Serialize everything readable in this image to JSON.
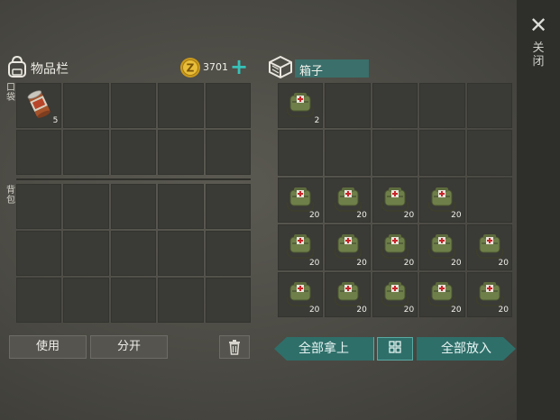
{
  "inventory": {
    "title": "物品栏",
    "coins": "3701",
    "pocket_label": "口袋",
    "backpack_label": "背包",
    "pocket_cells": [
      {
        "item": "canned-food",
        "qty": "5"
      },
      null,
      null,
      null,
      null,
      null,
      null,
      null,
      null,
      null
    ],
    "backpack_cells": [
      null,
      null,
      null,
      null,
      null,
      null,
      null,
      null,
      null,
      null,
      null,
      null,
      null,
      null,
      null
    ]
  },
  "box": {
    "title": "箱子",
    "cells": [
      {
        "item": "medkit-bag",
        "qty": "2"
      },
      null,
      null,
      null,
      null,
      null,
      null,
      null,
      null,
      null,
      {
        "item": "medkit-bag",
        "qty": "20"
      },
      {
        "item": "medkit-bag",
        "qty": "20"
      },
      {
        "item": "medkit-bag",
        "qty": "20"
      },
      {
        "item": "medkit-bag",
        "qty": "20"
      },
      null,
      {
        "item": "medkit-bag",
        "qty": "20"
      },
      {
        "item": "medkit-bag",
        "qty": "20"
      },
      {
        "item": "medkit-bag",
        "qty": "20"
      },
      {
        "item": "medkit-bag",
        "qty": "20"
      },
      {
        "item": "medkit-bag",
        "qty": "20"
      },
      {
        "item": "medkit-bag",
        "qty": "20"
      },
      {
        "item": "medkit-bag",
        "qty": "20"
      },
      {
        "item": "medkit-bag",
        "qty": "20"
      },
      {
        "item": "medkit-bag",
        "qty": "20"
      },
      {
        "item": "medkit-bag",
        "qty": "20"
      }
    ]
  },
  "buttons": {
    "use": "使用",
    "split": "分开",
    "take_all": "全部拿上",
    "put_all": "全部放入",
    "close_label": "关闭",
    "close_icon": "close-icon",
    "trash_icon": "trash-icon",
    "sort_icon": "grid-sort-icon",
    "plus_icon": "plus-icon"
  },
  "colors": {
    "accent": "#2f6f6a",
    "plus": "#37c1b8"
  }
}
